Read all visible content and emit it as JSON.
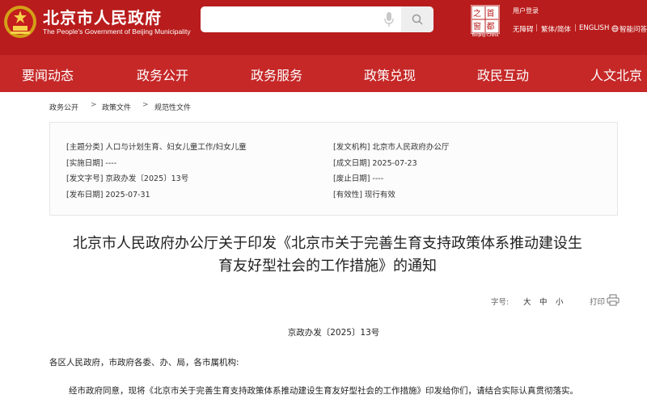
{
  "header": {
    "site_title": "北京市人民政府",
    "site_subtitle": "The People's Government of Beijing Municipality",
    "search": {
      "placeholder": "",
      "value": ""
    },
    "logo_caption": "Beijing·China",
    "logo_glyphs": [
      "首",
      "都",
      "之",
      "窗"
    ],
    "user_login": "用户登录",
    "utility_links": [
      "无障碍",
      "繁体/简体",
      "ENGLISH",
      "智能问答"
    ],
    "utility_separator": "|",
    "colors": {
      "header_bg": "#b91c1c",
      "nav_bg": "#c62828"
    }
  },
  "nav": {
    "items": [
      "要闻动态",
      "政务公开",
      "政务服务",
      "政策兑现",
      "政民互动",
      "人文北京"
    ]
  },
  "breadcrumb": {
    "items": [
      "政务公开",
      "政策文件",
      "规范性文件"
    ],
    "separator": ">"
  },
  "meta": {
    "left": [
      "[主题分类] 人口与计划生育、妇女儿童工作/妇女儿童",
      "[实施日期] ----",
      "[发文字号] 京政办发〔2025〕13号",
      "[发布日期] 2025-07-31"
    ],
    "right": [
      "[发文机构] 北京市人民政府办公厅",
      "[成文日期] 2025-07-23",
      "[废止日期] ----",
      "[有效性] 现行有效"
    ]
  },
  "article": {
    "title_line1": "北京市人民政府办公厅关于印发《北京市关于完善生育支持政策体系推动建设生",
    "title_line2": "育友好型社会的工作措施》的通知",
    "font_size_label": "字号:",
    "font_size_options": [
      "大",
      "中",
      "小"
    ],
    "print_label": "打印",
    "doc_number": "京政办发〔2025〕13号",
    "salutation": "各区人民政府，市政府各委、办、局，各市属机构:",
    "body_line1": "经市政府同意，现将《北京市关于完善生育支持政策体系推动建设生育友好型社会的工作措施》印发给你们，请结合实际认真贯彻落实。"
  }
}
